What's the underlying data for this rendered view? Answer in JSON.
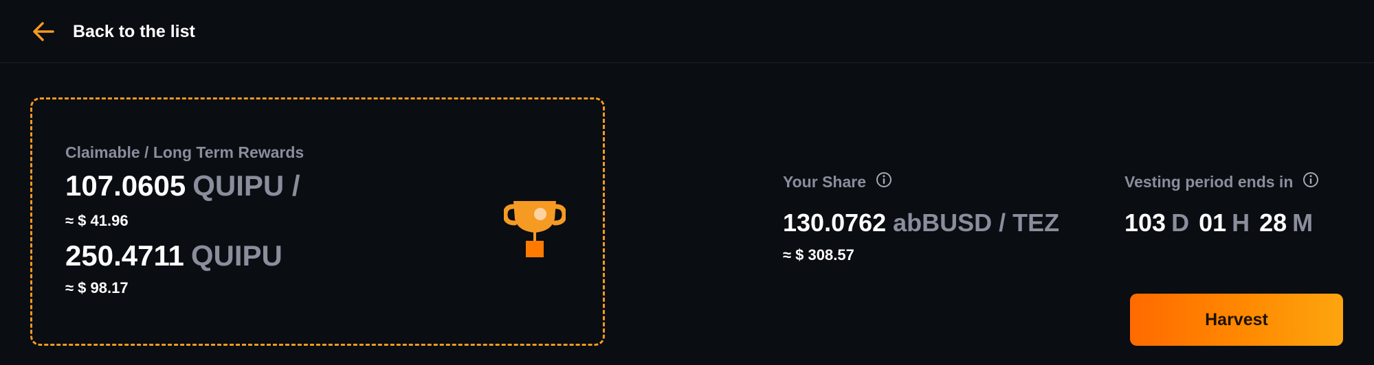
{
  "nav": {
    "back_label": "Back to the list",
    "back_icon": "arrow-left-icon"
  },
  "rewards": {
    "title": "Claimable / Long Term Rewards",
    "claimable_amount": "107.0605",
    "claimable_token": "QUIPU /",
    "claimable_usd": "≈ $ 41.96",
    "long_term_amount": "250.4711",
    "long_term_token": "QUIPU",
    "long_term_usd": "≈ $ 98.17",
    "icon": "trophy-icon"
  },
  "share": {
    "label": "Your Share",
    "amount": "130.0762",
    "pair": "abBUSD / TEZ",
    "usd": "≈ $ 308.57",
    "info_icon": "info-icon"
  },
  "vesting": {
    "label": "Vesting period ends in",
    "days": "103",
    "days_unit": "D",
    "hours": "01",
    "hours_unit": "H",
    "minutes": "28",
    "minutes_unit": "M",
    "info_icon": "info-icon"
  },
  "actions": {
    "harvest_label": "Harvest"
  },
  "colors": {
    "background": "#0a0d12",
    "accent": "#f59a23",
    "muted_text": "#8a8e9c",
    "button_gradient_start": "#ff6a00",
    "button_gradient_end": "#fda50f"
  }
}
